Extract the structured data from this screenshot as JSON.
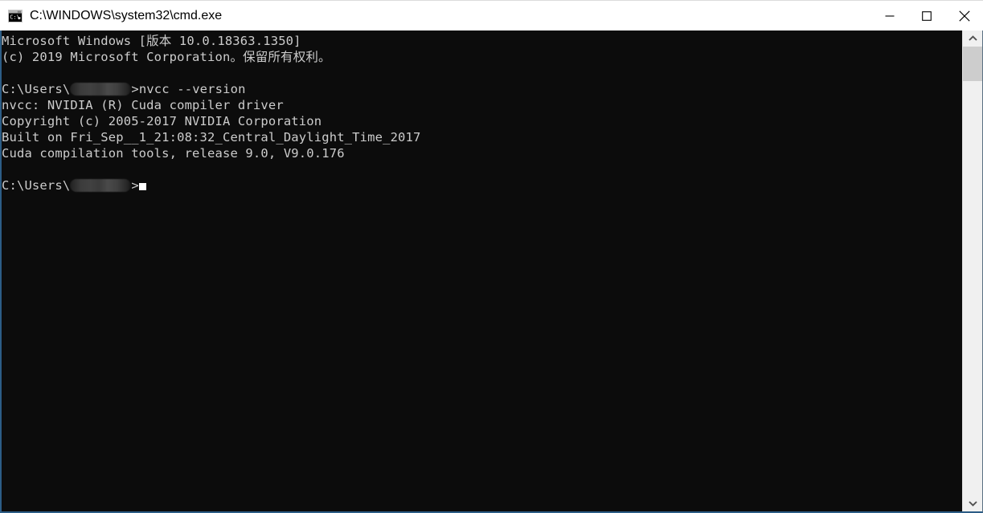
{
  "window": {
    "title": "C:\\WINDOWS\\system32\\cmd.exe",
    "icon": "cmd-console-icon",
    "titlebar_bg": "#ffffff",
    "terminal_bg": "#0c0c0c",
    "terminal_fg": "#cccccc",
    "border_color": "#2c5d86"
  },
  "controls": {
    "minimize_label": "—",
    "minimize_name": "minimize-icon",
    "maximize_label": "□",
    "maximize_name": "maximize-icon",
    "close_label": "✕",
    "close_name": "close-icon"
  },
  "terminal": {
    "lines": [
      {
        "text": "Microsoft Windows [版本 10.0.18363.1350]"
      },
      {
        "text": "(c) 2019 Microsoft Corporation。保留所有权利。"
      },
      {
        "text": ""
      },
      {
        "prefix": "C:\\Users\\",
        "redacted": true,
        "suffix": ">nvcc --version"
      },
      {
        "text": "nvcc: NVIDIA (R) Cuda compiler driver"
      },
      {
        "text": "Copyright (c) 2005-2017 NVIDIA Corporation"
      },
      {
        "text": "Built on Fri_Sep__1_21:08:32_Central_Daylight_Time_2017"
      },
      {
        "text": "Cuda compilation tools, release 9.0, V9.0.176"
      },
      {
        "text": ""
      },
      {
        "prefix": "C:\\Users\\",
        "redacted": true,
        "suffix": ">",
        "cursor": true
      }
    ],
    "command": "nvcc --version",
    "os_name": "Microsoft Windows",
    "os_version": "10.0.18363.1350",
    "copyright_line": "(c) 2019 Microsoft Corporation。保留所有权利。",
    "nvcc_driver": "nvcc: NVIDIA (R) Cuda compiler driver",
    "nvcc_copyright": "Copyright (c) 2005-2017 NVIDIA Corporation",
    "nvcc_built": "Built on Fri_Sep__1_21:08:32_Central_Daylight_Time_2017",
    "nvcc_release": "Cuda compilation tools, release 9.0, V9.0.176",
    "cuda_release": "9.0",
    "cuda_version": "V9.0.176"
  },
  "scrollbar": {
    "up_arrow_name": "scroll-up-arrow",
    "down_arrow_name": "scroll-down-arrow",
    "thumb_name": "scrollbar-thumb"
  }
}
